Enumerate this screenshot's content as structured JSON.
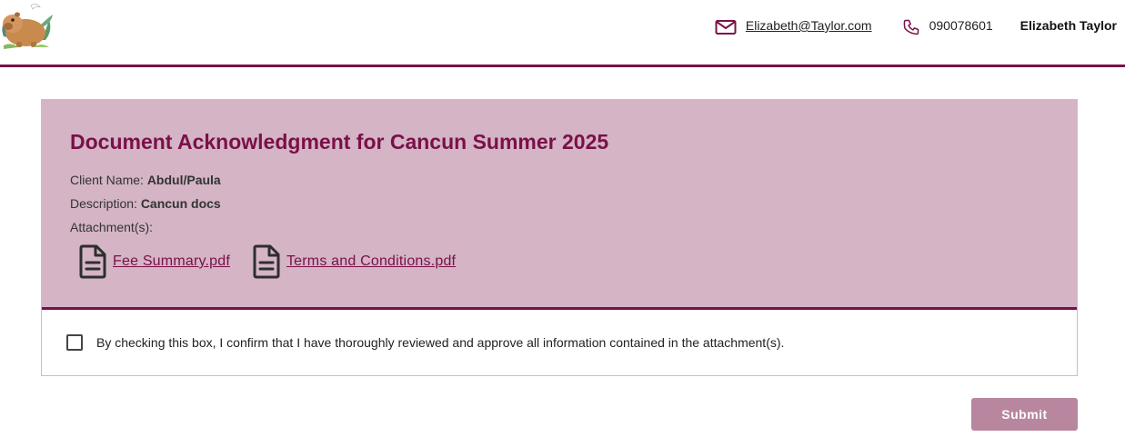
{
  "header": {
    "logo_icon": "capybara-logo",
    "email": "Elizabeth@Taylor.com",
    "phone": "090078601",
    "user_name": "Elizabeth Taylor",
    "accent_color": "#7a1048"
  },
  "document": {
    "title": "Document Acknowledgment for Cancun Summer 2025",
    "client_label": "Client Name: ",
    "client_value": "Abdul/Paula",
    "description_label": "Description: ",
    "description_value": "Cancun docs",
    "attachments_label": "Attachment(s):",
    "attachments": [
      {
        "name": "Fee Summary.pdf",
        "icon": "file-document-icon"
      },
      {
        "name": "Terms and Conditions.pdf",
        "icon": "file-document-icon"
      }
    ],
    "panel_color": "#d4b4c5"
  },
  "confirmation": {
    "checked": false,
    "text": "By checking this box, I confirm that I have thoroughly reviewed and approve all information contained in the attachment(s)."
  },
  "actions": {
    "submit_label": "Submit",
    "submit_color": "#b8869e"
  }
}
